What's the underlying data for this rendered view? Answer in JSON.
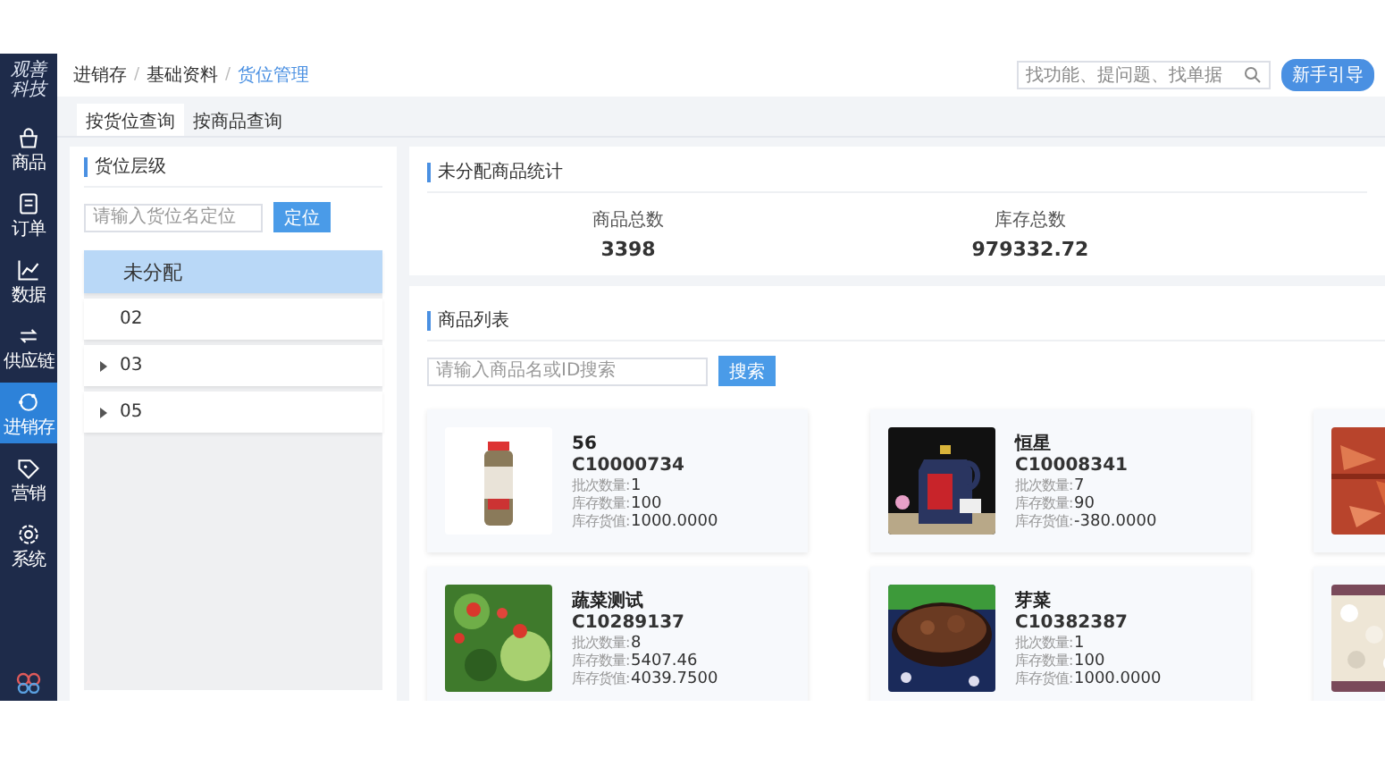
{
  "sidebar": {
    "logo": "观善科技",
    "items": [
      {
        "label": "商品",
        "selected": false
      },
      {
        "label": "订单",
        "selected": false
      },
      {
        "label": "数据",
        "selected": false
      },
      {
        "label": "供应链",
        "selected": false
      },
      {
        "label": "进销存",
        "selected": true
      },
      {
        "label": "营销",
        "selected": false
      },
      {
        "label": "系统",
        "selected": false
      }
    ]
  },
  "breadcrumb_separator": "/",
  "breadcrumb": [
    {
      "label": "进销存",
      "selected": false
    },
    {
      "label": "基础资料",
      "selected": false
    },
    {
      "label": "货位管理",
      "selected": true
    }
  ],
  "search": {
    "placeholder": "找功能、提问题、找单据"
  },
  "guide_button": "新手引导",
  "tabs": [
    {
      "label": "按货位查询",
      "selected": true
    },
    {
      "label": "按商品查询",
      "selected": false
    }
  ],
  "location_panel": {
    "title": "货位层级",
    "search": {
      "placeholder": "请输入货位名定位"
    },
    "button": "定位",
    "items": [
      {
        "label": "未分配",
        "selected": true,
        "expandable": false
      },
      {
        "label": "02",
        "selected": false,
        "expandable": false
      },
      {
        "label": "03",
        "selected": false,
        "expandable": true
      },
      {
        "label": "05",
        "selected": false,
        "expandable": true
      }
    ]
  },
  "stats_panel": {
    "title": "未分配商品统计",
    "stats": [
      {
        "label": "商品总数",
        "value": "3398"
      },
      {
        "label": "库存总数",
        "value": "979332.72"
      }
    ]
  },
  "product_panel": {
    "title": "商品列表",
    "search": {
      "placeholder": "请输入商品名或ID搜索"
    },
    "button": "搜索",
    "products": [
      {
        "name": "56",
        "code": "C10000734",
        "fields": [
          {
            "label": "批次数量:",
            "value": "1"
          },
          {
            "label": "库存数量:",
            "value": "100"
          },
          {
            "label": "库存货值:",
            "value": "1000.0000"
          }
        ]
      },
      {
        "name": "恒星",
        "code": "C10008341",
        "fields": [
          {
            "label": "批次数量:",
            "value": "7"
          },
          {
            "label": "库存数量:",
            "value": "90"
          },
          {
            "label": "库存货值:",
            "value": "-380.0000"
          }
        ]
      },
      {
        "kind": "picture"
      },
      {
        "name": "蔬菜测试",
        "code": "C10289137",
        "fields": [
          {
            "label": "批次数量:",
            "value": "8"
          },
          {
            "label": "库存数量:",
            "value": "5407.46"
          },
          {
            "label": "库存货值:",
            "value": "4039.7500"
          }
        ]
      },
      {
        "name": "芽菜",
        "code": "C10382387",
        "fields": [
          {
            "label": "批次数量:",
            "value": "1"
          },
          {
            "label": "库存数量:",
            "value": "100"
          },
          {
            "label": "库存货值:",
            "value": "1000.0000"
          }
        ]
      },
      {
        "kind": "picture"
      }
    ]
  }
}
